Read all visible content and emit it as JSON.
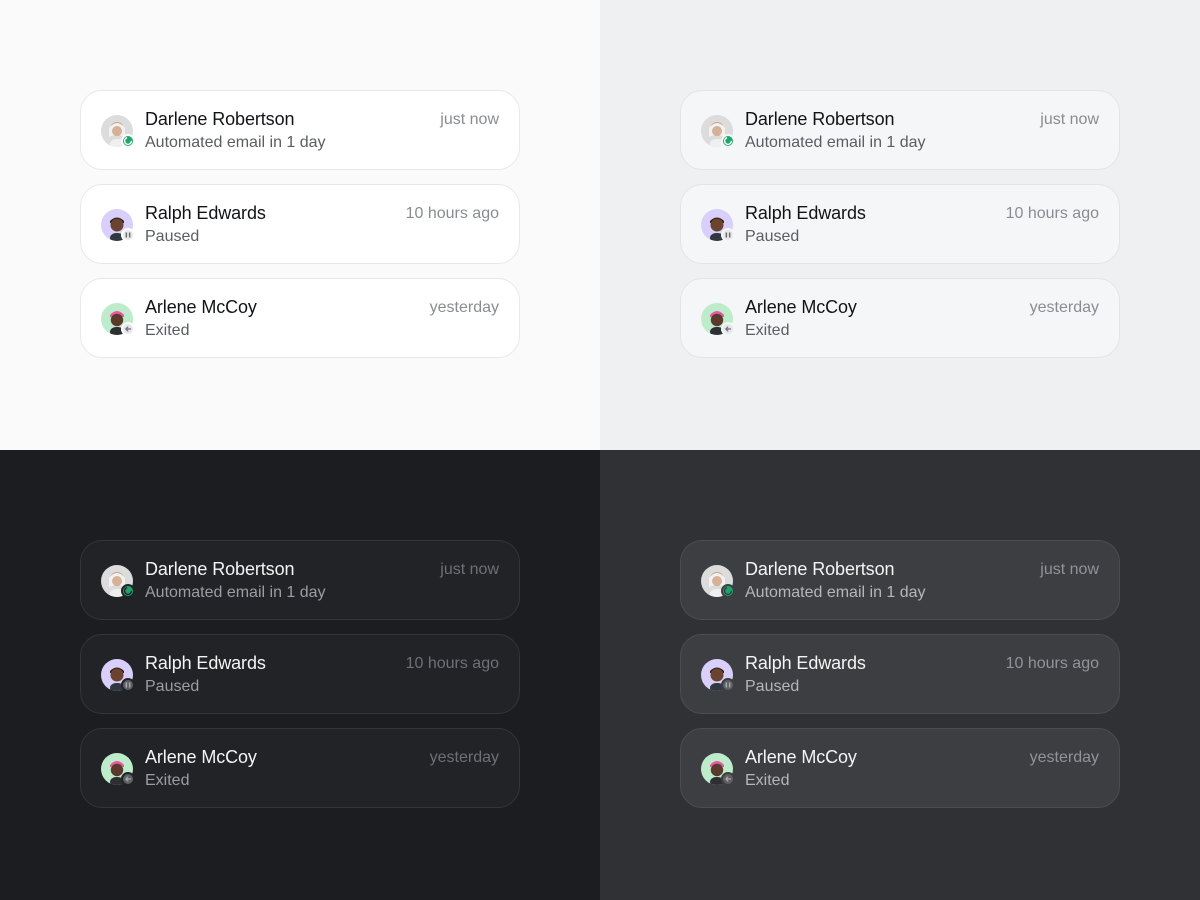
{
  "themes": [
    {
      "name": "light",
      "background": "#fafafa"
    },
    {
      "name": "light-gray",
      "background": "#eff0f2"
    },
    {
      "name": "dark",
      "background": "#1c1d21"
    },
    {
      "name": "dark-gray",
      "background": "#303135"
    }
  ],
  "contacts": [
    {
      "name": "Darlene Robertson",
      "status": "Automated email in 1 day",
      "time": "just now",
      "avatar_bg": "#dcdcdc",
      "badge": "progress-icon",
      "badge_color": "#1fa56c"
    },
    {
      "name": "Ralph Edwards",
      "status": "Paused",
      "time": "10 hours ago",
      "avatar_bg": "#d9cffb",
      "badge": "pause-icon",
      "badge_color": "#e6e7ea"
    },
    {
      "name": "Arlene McCoy",
      "status": "Exited",
      "time": "yesterday",
      "avatar_bg": "#bdeccb",
      "badge": "arrow-left-icon",
      "badge_color": "#e6e7ea"
    }
  ]
}
